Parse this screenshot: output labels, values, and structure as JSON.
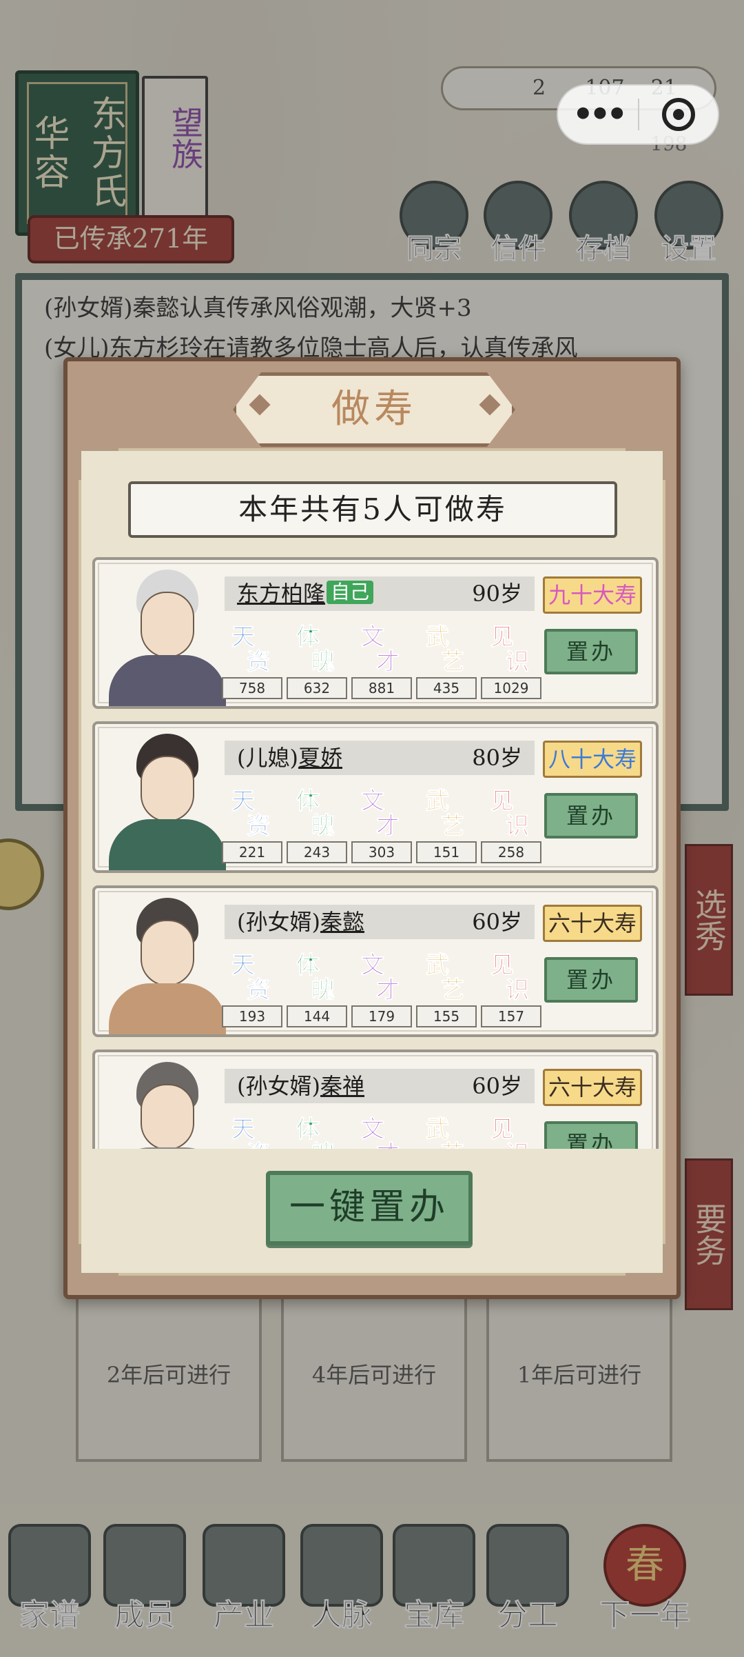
{
  "background": {
    "clan_book": {
      "cover_title_1": "华容",
      "cover_title_2": "东方氏",
      "page_text": "望族",
      "inherit_label": "已传承271年"
    },
    "resources": {
      "value_a": "2",
      "value_b": "107",
      "value_c": "21",
      "value_d": "198"
    },
    "top_menu": [
      {
        "label": "同宗"
      },
      {
        "label": "信件"
      },
      {
        "label": "存档"
      },
      {
        "label": "设置"
      }
    ],
    "log_lines": [
      "(孙女婿)秦懿认真传承风俗观潮，大贤+3",
      "(女儿)东方杉玲在请教多位隐士高人后，认真传承风"
    ],
    "side_tags": {
      "right_1": "选秀",
      "right_2": "要务"
    },
    "cards": [
      {
        "text": "2年后可进行"
      },
      {
        "text": "4年后可进行"
      },
      {
        "text": "1年后可进行"
      }
    ],
    "bottom_nav": [
      {
        "label": "家谱"
      },
      {
        "label": "成员"
      },
      {
        "label": "产业"
      },
      {
        "label": "人脉"
      },
      {
        "label": "宝库"
      },
      {
        "label": "分工"
      },
      {
        "label": "下一年",
        "badge": "春"
      }
    ]
  },
  "modal": {
    "title": "做寿",
    "summary": "本年共有5人可做寿",
    "stat_chars": [
      {
        "c1": "天",
        "c2": "资",
        "color": "#2c6fd6"
      },
      {
        "c1": "体",
        "c2": "魄",
        "color": "#1f9d57"
      },
      {
        "c1": "文",
        "c2": "才",
        "color": "#9a38c7"
      },
      {
        "c1": "武",
        "c2": "艺",
        "color": "#e0a020"
      },
      {
        "c1": "见",
        "c2": "识",
        "color": "#d83a3a"
      }
    ],
    "people": [
      {
        "prefix": "",
        "name": "东方柏隆",
        "self_badge": "自己",
        "age": "90岁",
        "tag": "九十大寿",
        "tag_color": "#d659c0",
        "action": "置办",
        "stats": [
          "758",
          "632",
          "881",
          "435",
          "1029"
        ],
        "hair_color": "#d8d8d8",
        "robe_color": "#5b5a6e"
      },
      {
        "prefix": "(儿媳)",
        "name": "夏娇",
        "self_badge": "",
        "age": "80岁",
        "tag": "八十大寿",
        "tag_color": "#3c7ad6",
        "action": "置办",
        "stats": [
          "221",
          "243",
          "303",
          "151",
          "258"
        ],
        "hair_color": "#3a3230",
        "robe_color": "#3e6a5a"
      },
      {
        "prefix": "(孙女婿)",
        "name": "秦懿",
        "self_badge": "",
        "age": "60岁",
        "tag": "六十大寿",
        "tag_color": "#3a2e20",
        "action": "置办",
        "stats": [
          "193",
          "144",
          "179",
          "155",
          "157"
        ],
        "hair_color": "#4a4442",
        "robe_color": "#c49a76"
      },
      {
        "prefix": "(孙女婿)",
        "name": "秦禅",
        "self_badge": "",
        "age": "60岁",
        "tag": "六十大寿",
        "tag_color": "#3a2e20",
        "action": "置办",
        "stats": [
          "",
          "",
          "",
          "",
          ""
        ],
        "hair_color": "#6c6866",
        "robe_color": "#8a8a8a"
      }
    ],
    "bulk_action": "一键置办"
  }
}
